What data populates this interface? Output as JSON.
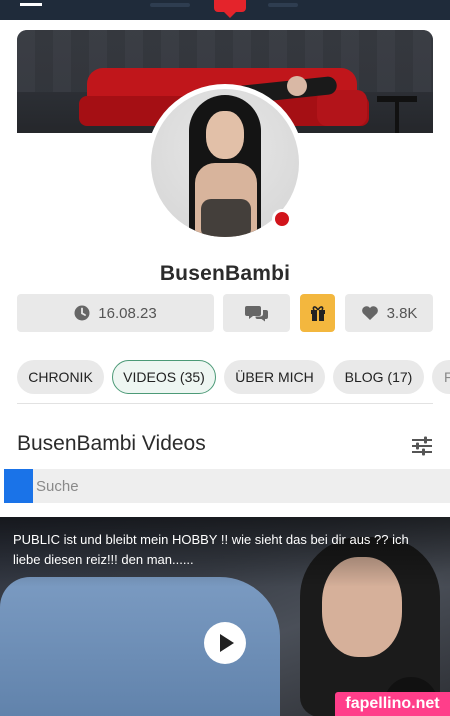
{
  "profile": {
    "username": "BusenBambi",
    "joined_date": "16.08.23",
    "likes": "3.8K",
    "online": true
  },
  "tabs": [
    {
      "label": "CHRONIK",
      "active": false
    },
    {
      "label": "VIDEOS (35)",
      "active": true
    },
    {
      "label": "ÜBER MICH",
      "active": false
    },
    {
      "label": "BLOG (17)",
      "active": false
    },
    {
      "label": "F",
      "active": false
    }
  ],
  "videos_section": {
    "title": "BusenBambi Videos",
    "search_placeholder": "Suche"
  },
  "video": {
    "caption": "PUBLIC ist und bleibt mein HOBBY !! wie sieht das bei dir aus ?? ich liebe diesen reiz!!! den man......"
  },
  "watermark": "fapellino.net",
  "colors": {
    "topbar": "#1f2b3a",
    "brand_red": "#e4242b",
    "gift": "#f3b73e",
    "active_tab_border": "#4c9a77",
    "search_button": "#1a73e8",
    "online_dot": "#d1141b"
  },
  "icons": {
    "menu": "menu-icon",
    "clock": "clock-icon",
    "chat": "chat-icon",
    "gift": "gift-icon",
    "heart": "heart-icon",
    "filter": "filter-icon",
    "play": "play-icon"
  }
}
